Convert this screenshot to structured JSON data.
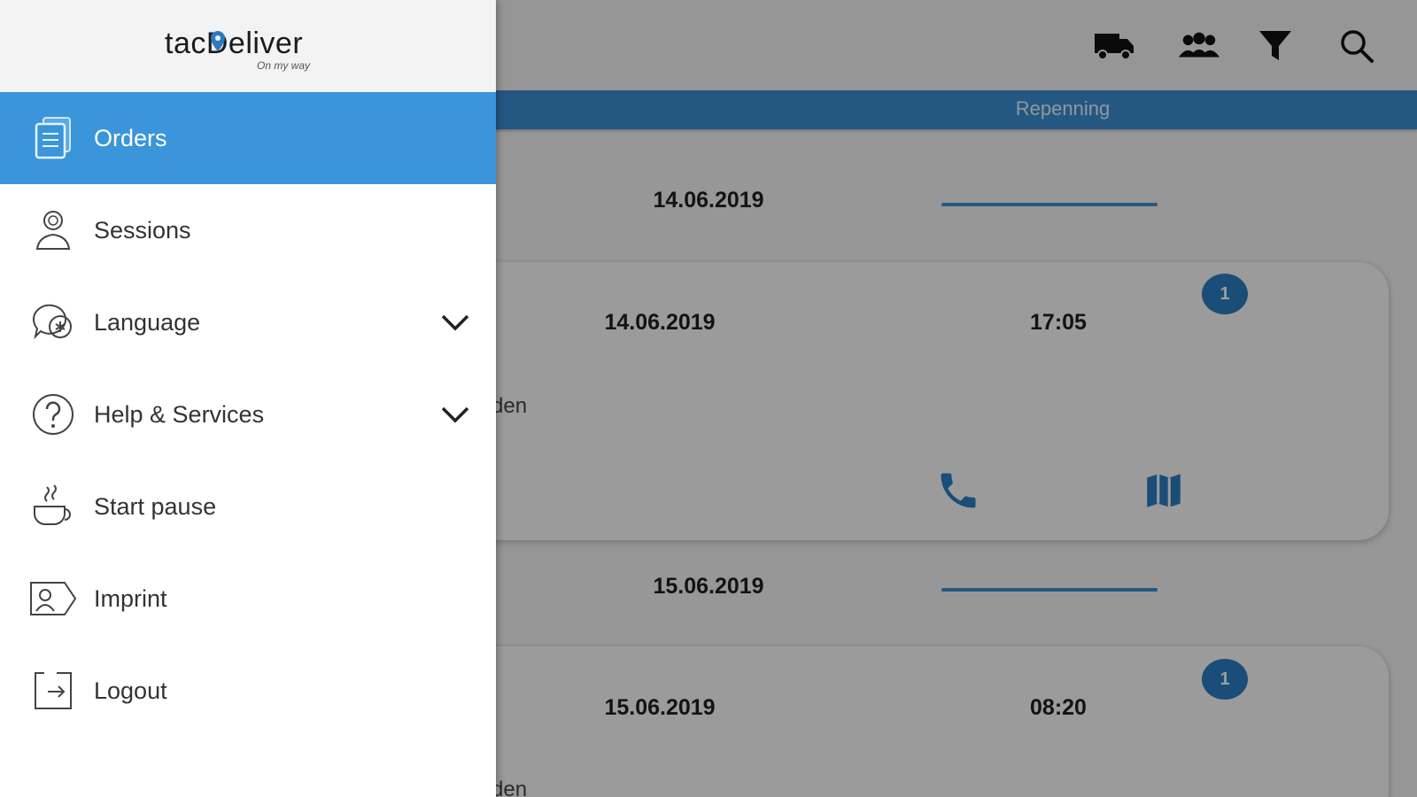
{
  "app": {
    "tab_label": "Repenning",
    "top_icons": [
      "truck-icon",
      "group-icon",
      "filter-icon",
      "search-icon"
    ],
    "groups": [
      {
        "date_header": "14.06.2019",
        "card": {
          "date": "14.06.2019",
          "time": "17:05",
          "badge": "1",
          "subtitle": "den"
        }
      },
      {
        "date_header": "15.06.2019",
        "card": {
          "date": "15.06.2019",
          "time": "08:20",
          "badge": "1",
          "subtitle": "den"
        }
      }
    ],
    "colors": {
      "accent": "#3a8fd2",
      "badge": "#2a7cc0",
      "drawer_active": "#3a95db"
    }
  },
  "drawer": {
    "logo_text": "tacDeliver",
    "logo_tagline": "On my way",
    "items": [
      {
        "label": "Orders",
        "icon": "orders-icon",
        "active": true
      },
      {
        "label": "Sessions",
        "icon": "user-icon"
      },
      {
        "label": "Language",
        "icon": "language-icon",
        "expandable": true
      },
      {
        "label": "Help & Services",
        "icon": "help-icon",
        "expandable": true
      },
      {
        "label": "Start pause",
        "icon": "coffee-icon"
      },
      {
        "label": "Imprint",
        "icon": "imprint-icon"
      },
      {
        "label": "Logout",
        "icon": "logout-icon"
      }
    ]
  }
}
